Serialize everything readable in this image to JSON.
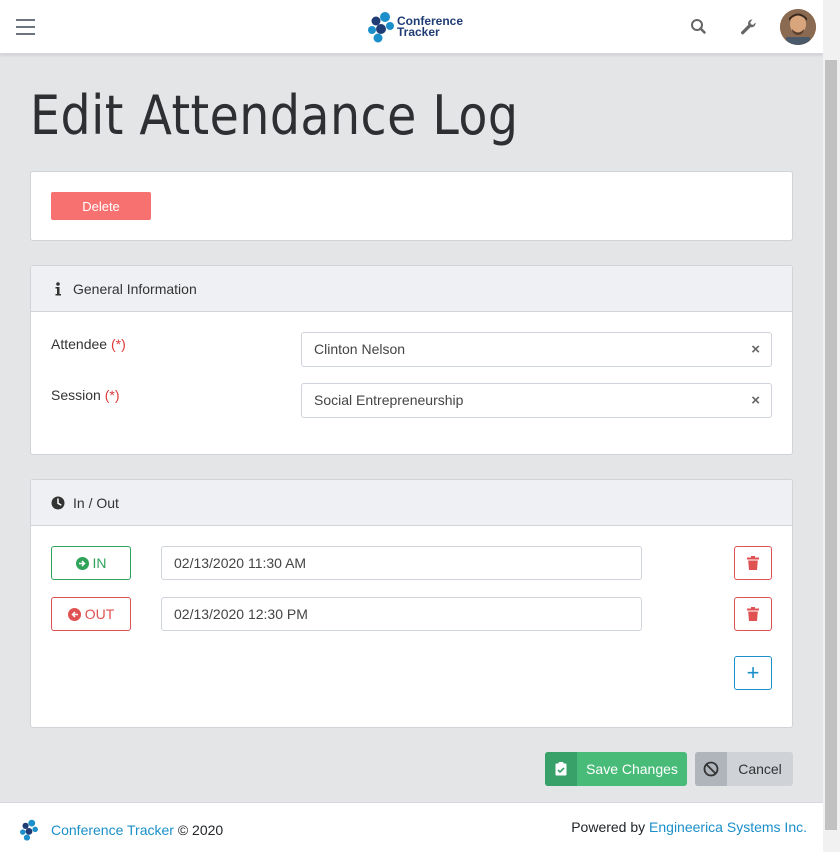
{
  "header": {
    "logo_line1": "Conference",
    "logo_line2": "Tracker"
  },
  "page": {
    "title": "Edit Attendance Log"
  },
  "actions": {
    "delete_label": "Delete"
  },
  "general": {
    "header": "General Information",
    "attendee_label": "Attendee",
    "session_label": "Session",
    "required_mark": "(*)",
    "attendee_value": "Clinton Nelson",
    "session_value": "Social Entrepreneurship",
    "clear_glyph": "×"
  },
  "inout": {
    "header": "In / Out",
    "entries": [
      {
        "type_label": "IN",
        "time": "02/13/2020 11:30 AM"
      },
      {
        "type_label": "OUT",
        "time": "02/13/2020 12:30 PM"
      }
    ],
    "add_glyph": "+"
  },
  "form_actions": {
    "save_label": "Save Changes",
    "cancel_label": "Cancel"
  },
  "footer": {
    "brand": "Conference Tracker",
    "copyright": "© 2020",
    "powered_by": "Powered by",
    "company": "Engineerica Systems Inc."
  },
  "colors": {
    "accent": "#1a8fc9",
    "success": "#48bb78",
    "danger": "#f87171"
  }
}
